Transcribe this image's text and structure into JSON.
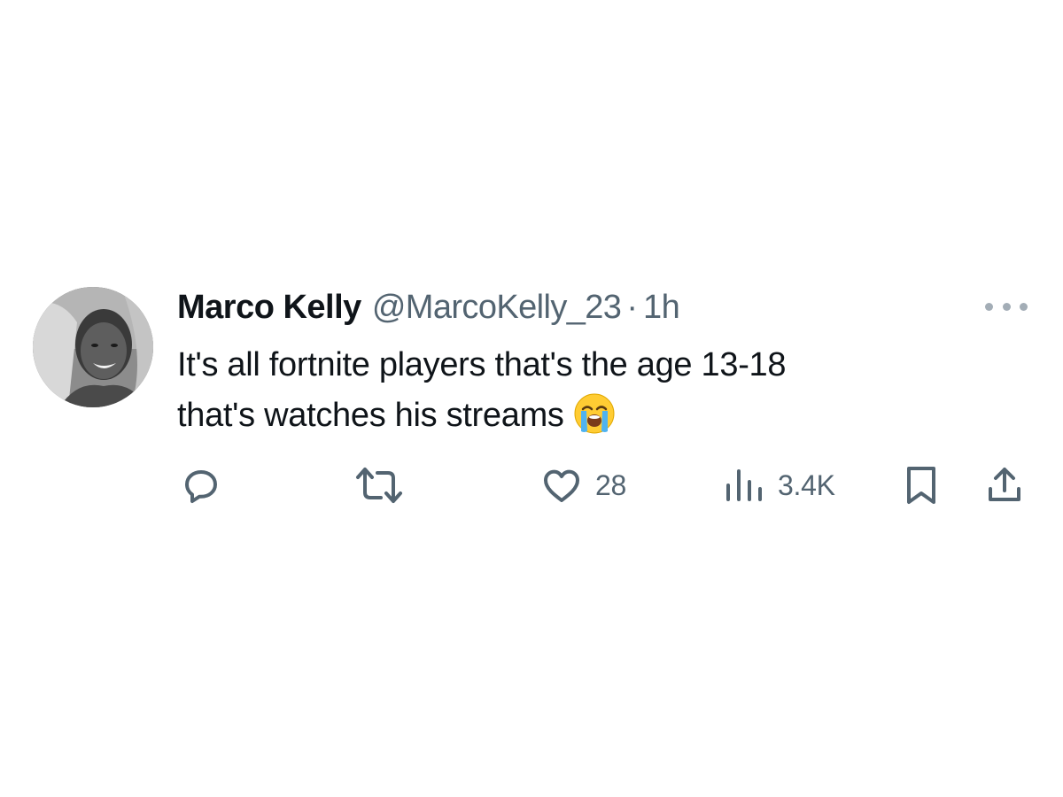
{
  "tweet": {
    "display_name": "Marco Kelly",
    "handle": "@MarcoKelly_23",
    "separator": "·",
    "time": "1h",
    "text_line1": "It's all fortnite players that's the age 13-18",
    "text_line2": "that's watches his streams",
    "emoji": "loudly-crying-face"
  },
  "actions": {
    "reply_icon": "reply-icon",
    "retweet_icon": "retweet-icon",
    "like_icon": "heart-icon",
    "like_count": "28",
    "views_icon": "views-icon",
    "views_count": "3.4K",
    "bookmark_icon": "bookmark-icon",
    "share_icon": "share-icon"
  },
  "colors": {
    "text_primary": "#0f1419",
    "text_secondary": "#536471",
    "background": "#ffffff"
  }
}
